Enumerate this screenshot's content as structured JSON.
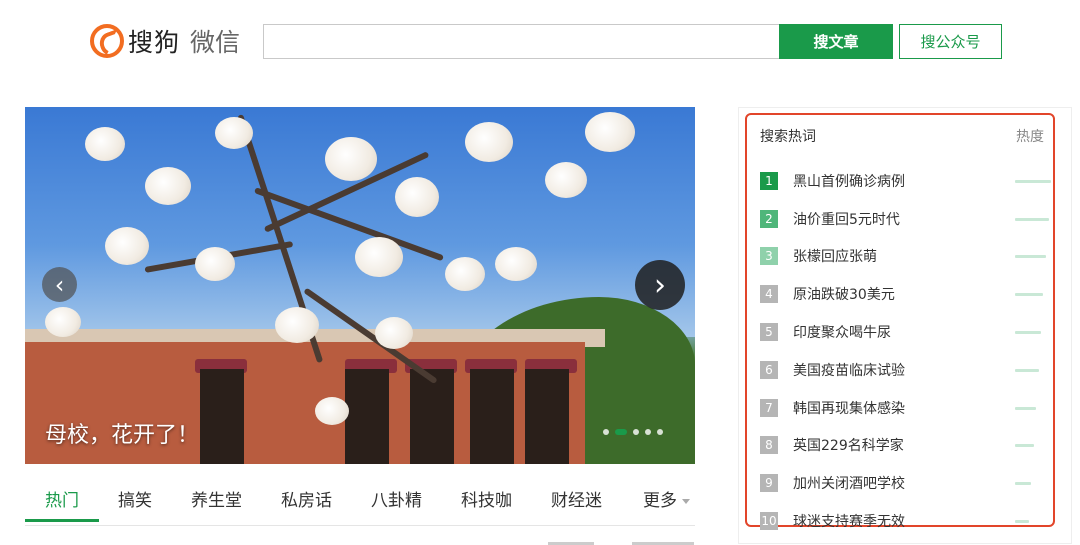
{
  "logo": {
    "brand": "搜狗",
    "product": "微信"
  },
  "search": {
    "value": "",
    "placeholder": "",
    "article_button": "搜文章",
    "account_button": "搜公众号"
  },
  "carousel": {
    "caption": "母校，花开了！",
    "slide_count": 5,
    "active_slide": 2
  },
  "tabs": [
    "热门",
    "搞笑",
    "养生堂",
    "私房话",
    "八卦精",
    "科技咖",
    "财经迷",
    "更多"
  ],
  "active_tab": 0,
  "hot": {
    "title": "搜索热词",
    "heat_label": "热度",
    "items": [
      {
        "rank": "1",
        "text": "黑山首例确诊病例",
        "heat": 1.0
      },
      {
        "rank": "2",
        "text": "油价重回5元时代",
        "heat": 0.95
      },
      {
        "rank": "3",
        "text": "张檬回应张萌",
        "heat": 0.85
      },
      {
        "rank": "4",
        "text": "原油跌破30美元",
        "heat": 0.78
      },
      {
        "rank": "5",
        "text": "印度聚众喝牛尿",
        "heat": 0.72
      },
      {
        "rank": "6",
        "text": "美国疫苗临床试验",
        "heat": 0.66
      },
      {
        "rank": "7",
        "text": "韩国再现集体感染",
        "heat": 0.58
      },
      {
        "rank": "8",
        "text": "英国229名科学家",
        "heat": 0.52
      },
      {
        "rank": "9",
        "text": "加州关闭酒吧学校",
        "heat": 0.45
      },
      {
        "rank": "10",
        "text": "球迷支持赛季无效",
        "heat": 0.38
      }
    ]
  },
  "colors": {
    "accent": "#1a9a4a",
    "highlight_border": "#e2452a"
  },
  "icons": {
    "prev": "chevron-left-icon",
    "next": "chevron-right-icon",
    "more": "caret-down-icon"
  }
}
